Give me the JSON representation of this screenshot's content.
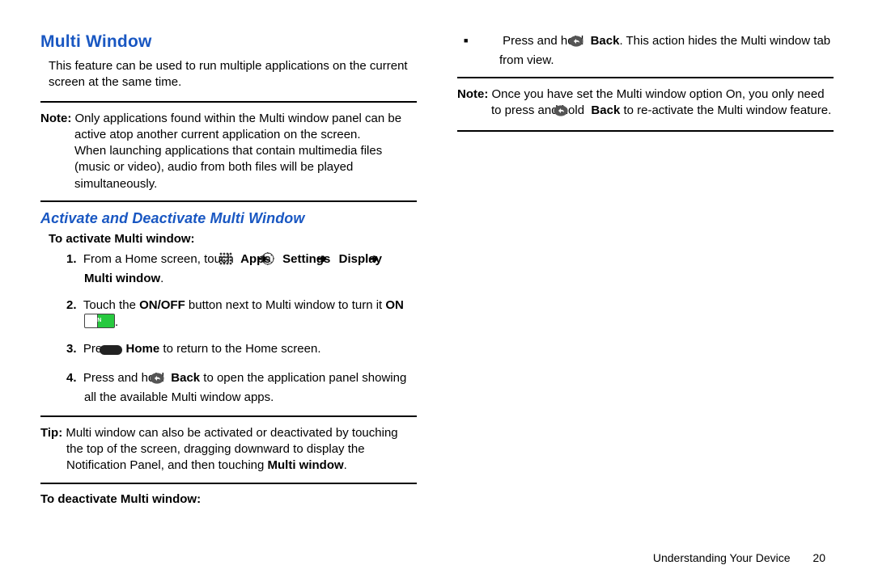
{
  "heading": "Multi Window",
  "intro": "This feature can be used to run multiple applications on the current screen at the same time.",
  "note1": {
    "label": "Note:",
    "body_a": "Only applications found within the Multi window panel can be active atop another current application on the screen.",
    "body_b": "When launching applications that contain multimedia files (music or video), audio from both files will be played simultaneously."
  },
  "subheading": "Activate and Deactivate Multi Window",
  "activate_label": "To activate Multi window:",
  "steps": {
    "s1": {
      "num": "1.",
      "pre": "From a Home screen, touch ",
      "apps": "Apps",
      "settings": "Settings",
      "display": "Display",
      "multi": "Multi window",
      "dot": "."
    },
    "s2": {
      "num": "2.",
      "pre": "Touch the ",
      "onoff": "ON/OFF",
      "mid": " button next to Multi window to turn it ",
      "on": "ON",
      "switchText": "ON",
      "dot": "."
    },
    "s3": {
      "num": "3.",
      "pre": "Press ",
      "home": "Home",
      "post": " to return to the Home screen."
    },
    "s4": {
      "num": "4.",
      "pre": "Press and hold ",
      "back": "Back",
      "post": " to open the application panel showing all the available Multi window apps."
    }
  },
  "tip": {
    "label": "Tip:",
    "pre": "Multi window can also be activated or deactivated by touching the top of the screen, dragging downward to display the Notification Panel, and then touching ",
    "multi": "Multi window",
    "dot": "."
  },
  "deactivate_label": "To deactivate Multi window:",
  "deactivate": {
    "pre": "Press and hold ",
    "back": "Back",
    "post": ". This action hides the Multi window tab from view."
  },
  "note2": {
    "label": "Note:",
    "pre": "Once you have set the Multi window option On, you only need to press and hold ",
    "back": "Back",
    "post": " to re-activate the Multi window feature."
  },
  "footer": {
    "section": "Understanding Your Device",
    "page": "20"
  },
  "arrow": "➔"
}
